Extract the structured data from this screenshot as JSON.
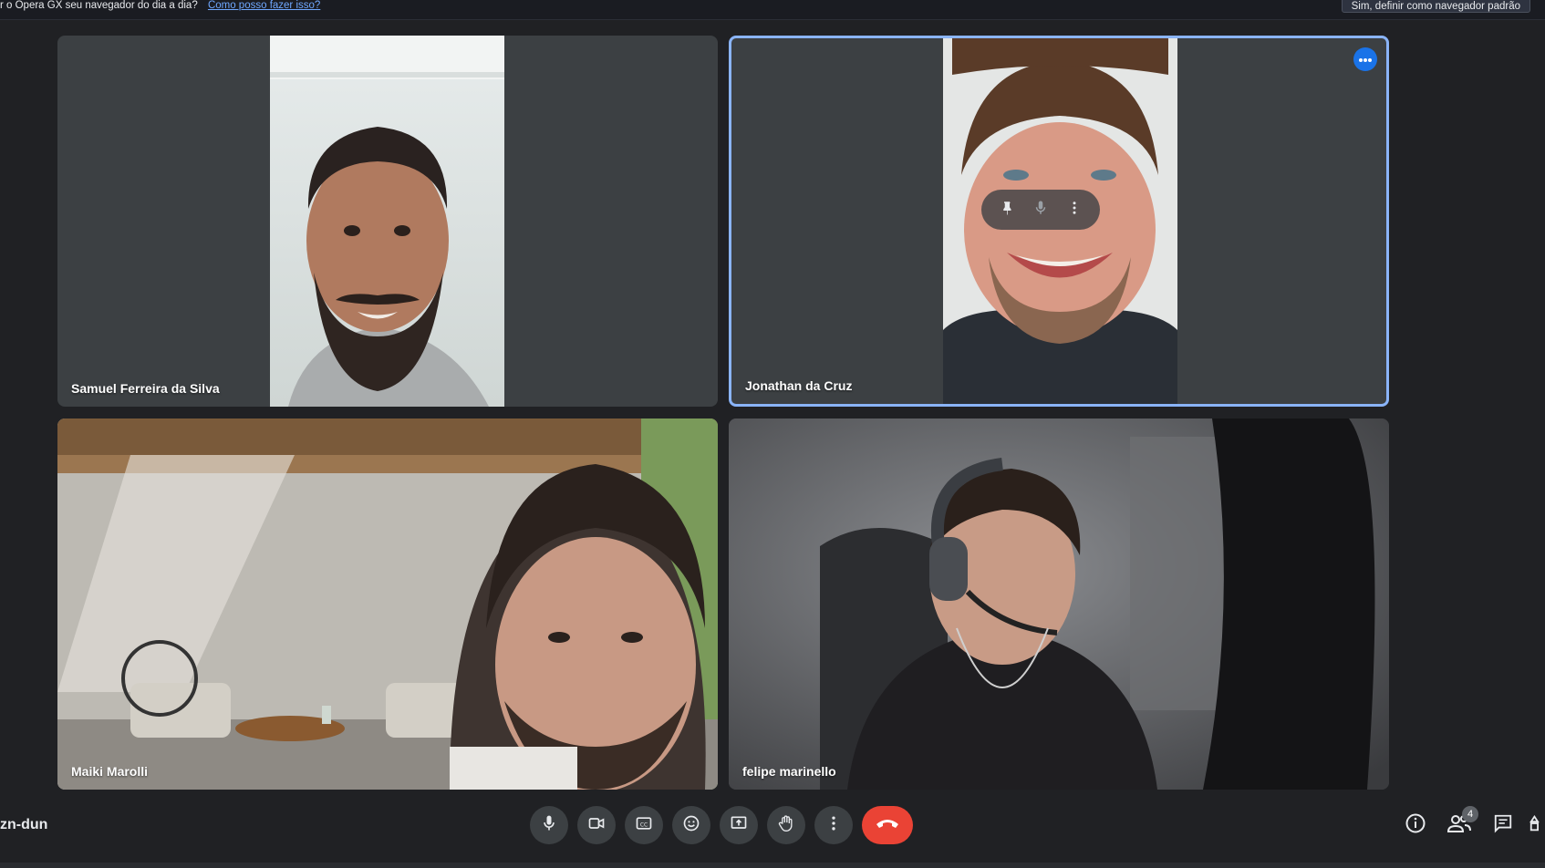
{
  "browser_banner": {
    "message": "r o Opera GX seu navegador do dia a dia?",
    "link": "Como posso fazer isso?",
    "button": "Sim, definir como navegador padrão"
  },
  "participants": [
    {
      "name": "Samuel Ferreira da Silva",
      "active": false
    },
    {
      "name": "Jonathan da Cruz",
      "active": true
    },
    {
      "name": "Maiki Marolli",
      "active": false
    },
    {
      "name": "felipe marinello",
      "active": false
    }
  ],
  "meeting": {
    "code_fragment": "zn-dun",
    "people_count": "4"
  },
  "colors": {
    "end_call": "#ea4335",
    "active_border": "#8ab4f8",
    "tile_bg": "#3c4043",
    "page_bg": "#202124"
  },
  "icons": [
    "mic-icon",
    "camera-icon",
    "captions-icon",
    "emoji-icon",
    "present-icon",
    "raise-hand-icon",
    "more-options-icon",
    "end-call-icon",
    "info-icon",
    "people-icon",
    "chat-icon",
    "activities-icon",
    "pin-icon"
  ]
}
